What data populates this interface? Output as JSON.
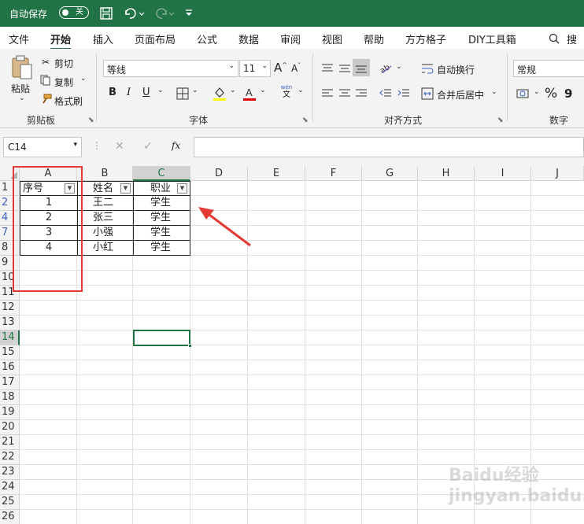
{
  "titlebar": {
    "autosave": "自动保存",
    "toggle": "关"
  },
  "tabs": [
    "文件",
    "开始",
    "插入",
    "页面布局",
    "公式",
    "数据",
    "审阅",
    "视图",
    "帮助",
    "方方格子",
    "DIY工具箱",
    "搜索"
  ],
  "ribbon": {
    "paste": "粘贴",
    "cut": "剪切",
    "copy": "复制",
    "format_painter": "格式刷",
    "clipboard": "剪贴板",
    "font_name": "等线",
    "font_size": "11",
    "font_group": "字体",
    "bold": "B",
    "italic": "I",
    "underline": "U",
    "phonetic_top": "wén",
    "phonetic_bottom": "文",
    "wrap": "自动换行",
    "merge": "合并后居中",
    "align_group": "对齐方式",
    "number_format": "常规",
    "percent": "%",
    "comma": "9",
    "number_group": "数字"
  },
  "formula_bar": {
    "name_box": "C14",
    "cancel": "✕",
    "enter": "✓",
    "fx": "fx",
    "value": ""
  },
  "columns": [
    "A",
    "B",
    "C",
    "D",
    "E",
    "F",
    "G",
    "H",
    "I",
    "J"
  ],
  "rows": [
    "1",
    "2",
    "4",
    "7",
    "8",
    "9",
    "10",
    "11",
    "12",
    "13",
    "14",
    "15",
    "16",
    "17",
    "18",
    "19",
    "20",
    "21",
    "22",
    "23",
    "24",
    "25",
    "26"
  ],
  "table": {
    "headers": [
      "序号",
      "姓名",
      "职业"
    ],
    "records": [
      [
        "1",
        "王二",
        "学生"
      ],
      [
        "2",
        "张三",
        "学生"
      ],
      [
        "3",
        "小强",
        "学生"
      ],
      [
        "4",
        "小红",
        "学生"
      ]
    ]
  },
  "watermark": "Baidu经验 jingyan.baidu.com",
  "colors": {
    "excel_green": "#217346",
    "annotation_red": "#e53935"
  }
}
